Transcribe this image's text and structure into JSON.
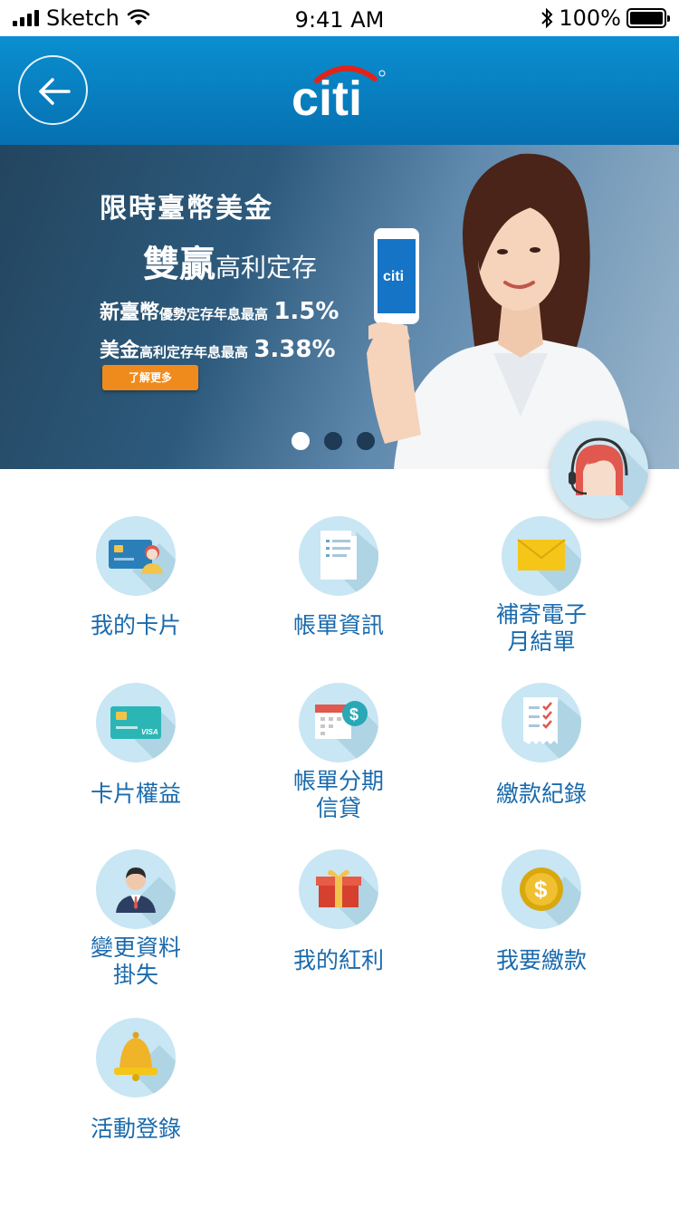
{
  "status_bar": {
    "carrier": "Sketch",
    "time": "9:41 AM",
    "battery_text": "100%",
    "battery_level": 1.0
  },
  "header": {
    "logo_text": "citi",
    "back_icon": "arrow-left-icon"
  },
  "banner": {
    "line1": "限時臺幣美金",
    "line2_bold": "雙贏",
    "line2_rest": "高利定存",
    "line3_a": "新臺幣",
    "line3_b": "優勢定存年息最高",
    "line3_rate": "1.5%",
    "line4_a": "美金",
    "line4_b": "高利定存年息最高",
    "line4_rate": "3.38%",
    "cta": "了解更多",
    "phone_logo": "citi",
    "slides": 3,
    "active_slide": 0
  },
  "colors": {
    "header": "#0670b1",
    "label": "#1a6aad",
    "icon_bg": "#c8e6f3",
    "cta": "#ef8b1d"
  },
  "menu": [
    {
      "label_1": "我的卡片",
      "label_2": "",
      "icon": "credit-card-person-icon"
    },
    {
      "label_1": "帳單資訊",
      "label_2": "",
      "icon": "document-icon"
    },
    {
      "label_1": "補寄電子",
      "label_2": "月結單",
      "icon": "envelope-icon"
    },
    {
      "label_1": "卡片權益",
      "label_2": "",
      "icon": "visa-card-icon"
    },
    {
      "label_1": "帳單分期",
      "label_2": "信貸",
      "icon": "calendar-dollar-icon"
    },
    {
      "label_1": "繳款紀錄",
      "label_2": "",
      "icon": "checklist-receipt-icon"
    },
    {
      "label_1": "變更資料",
      "label_2": "掛失",
      "icon": "businessman-icon"
    },
    {
      "label_1": "我的紅利",
      "label_2": "",
      "icon": "gift-box-icon"
    },
    {
      "label_1": "我要繳款",
      "label_2": "",
      "icon": "dollar-coin-icon"
    },
    {
      "label_1": "活動登錄",
      "label_2": "",
      "icon": "bell-icon"
    }
  ]
}
